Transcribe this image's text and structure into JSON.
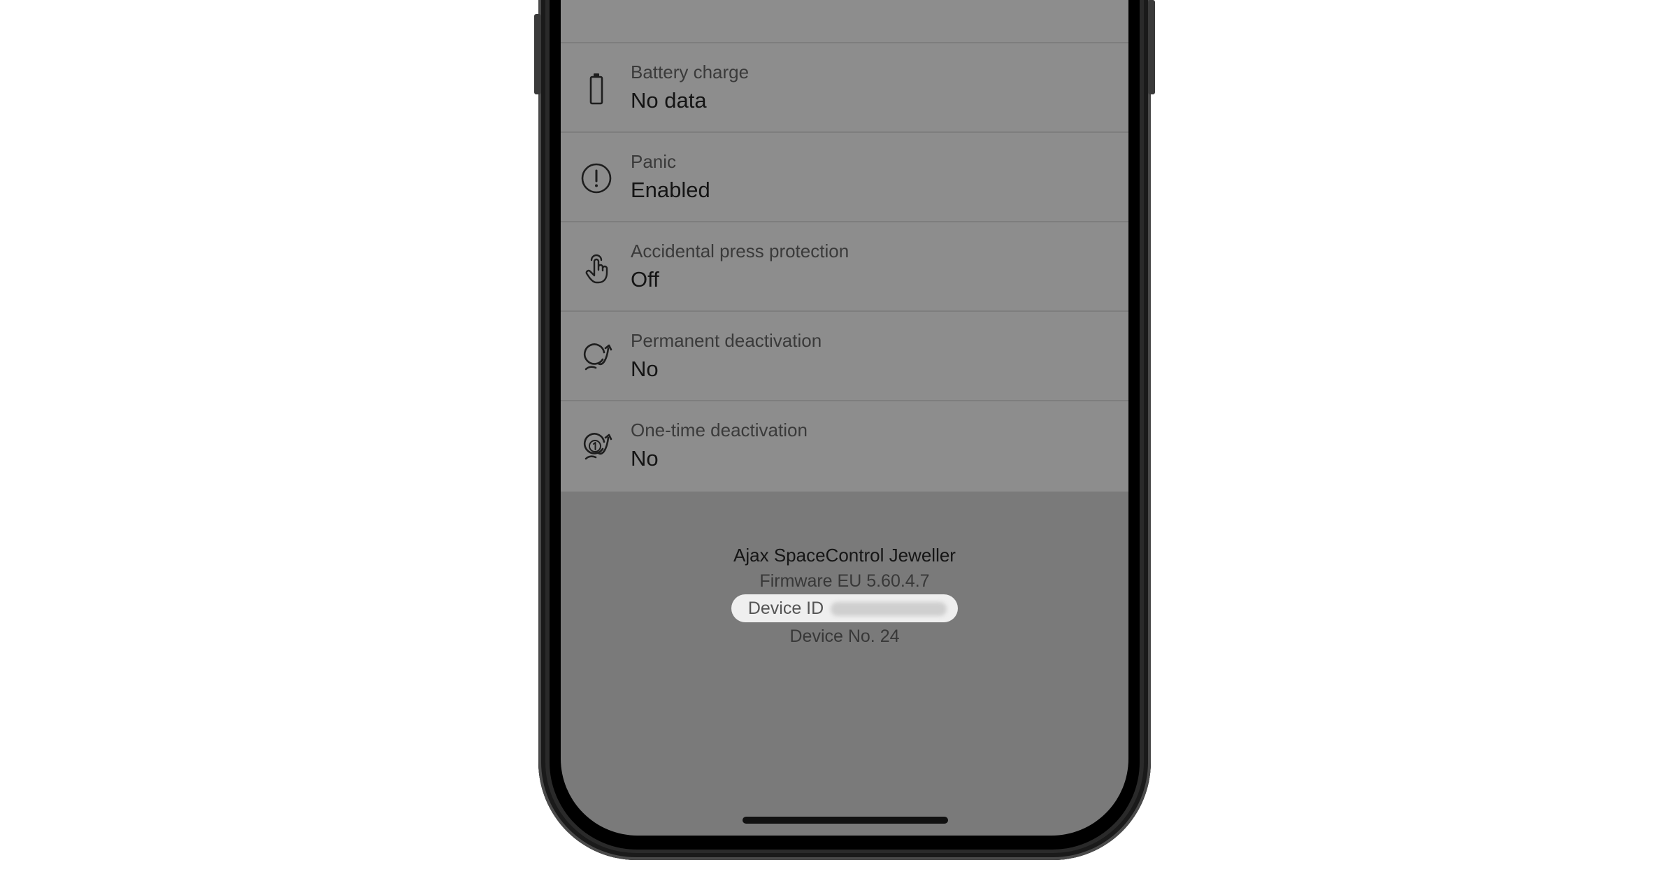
{
  "settings": {
    "items": [
      {
        "icon": "battery-icon",
        "label": "Battery charge",
        "value": "No data"
      },
      {
        "icon": "panic-exclamation-icon",
        "label": "Panic",
        "value": "Enabled"
      },
      {
        "icon": "press-hand-icon",
        "label": "Accidental press protection",
        "value": "Off"
      },
      {
        "icon": "permanent-deactivation-icon",
        "label": "Permanent deactivation",
        "value": "No"
      },
      {
        "icon": "one-time-deactivation-icon",
        "label": "One-time deactivation",
        "value": "No"
      }
    ]
  },
  "device_info": {
    "model": "Ajax SpaceControl Jeweller",
    "firmware": "Firmware EU 5.60.4.7",
    "device_id_label": "Device ID",
    "device_number": "Device No. 24"
  }
}
